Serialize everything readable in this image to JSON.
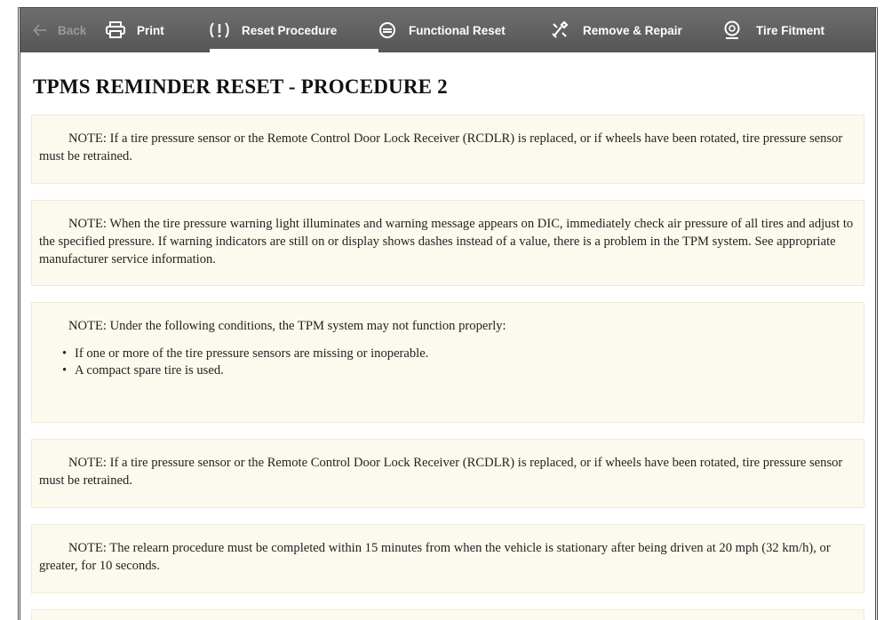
{
  "toolbar": {
    "items": [
      {
        "label": "Back",
        "icon": "left-arrow-icon",
        "state": "disabled"
      },
      {
        "label": "Print",
        "icon": "printer-icon",
        "state": "normal"
      },
      {
        "label": "Reset Procedure",
        "icon": "tpms-warning-icon",
        "state": "active"
      },
      {
        "label": "Functional Reset",
        "icon": "functional-reset-icon",
        "state": "normal"
      },
      {
        "label": "Remove & Repair",
        "icon": "wrench-icon",
        "state": "normal"
      },
      {
        "label": "Tire Fitment",
        "icon": "tire-icon",
        "state": "normal"
      }
    ]
  },
  "page": {
    "title": "TPMS REMINDER RESET - PROCEDURE 2"
  },
  "notes": [
    {
      "text": "NOTE: If a tire pressure sensor or the Remote Control Door Lock Receiver (RCDLR) is replaced, or if wheels have been rotated, tire pressure sensor must be retrained."
    },
    {
      "text": "NOTE: When the tire pressure warning light illuminates and warning message appears on DIC, immediately check air pressure of all tires and adjust to the specified pressure. If warning indicators are still on or display shows dashes instead of a value, there is a problem in the TPM system. See appropriate manufacturer service information."
    },
    {
      "text": "NOTE: Under the following conditions, the TPM system may not function properly:",
      "bullets": [
        "If one or more of the tire pressure sensors are missing or inoperable.",
        "A compact spare tire is used."
      ]
    },
    {
      "text": "NOTE: If a tire pressure sensor or the Remote Control Door Lock Receiver (RCDLR) is replaced, or if wheels have been rotated, tire pressure sensor must be retrained."
    },
    {
      "text": "NOTE: The relearn procedure must be completed within 15 minutes from when the vehicle is stationary after being driven at 20 mph (32 km/h), or greater, for 10 seconds."
    }
  ],
  "colors": {
    "toolbar_bg": "#606060",
    "note_bg": "#fcfaee",
    "note_border": "#ecebdb"
  }
}
